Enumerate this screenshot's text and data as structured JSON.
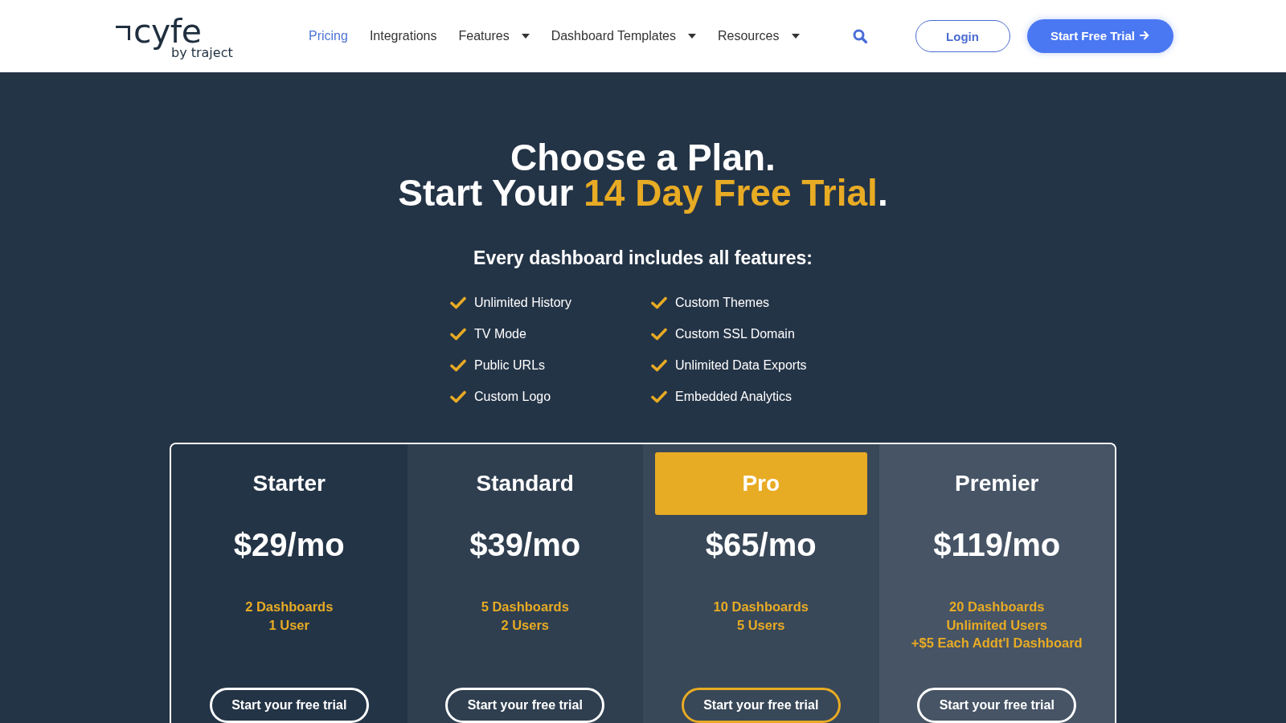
{
  "header": {
    "logo": {
      "wordmark": "cyfe",
      "tagline": "by traject"
    },
    "nav": [
      {
        "label": "Pricing",
        "selected": true,
        "kind": "link"
      },
      {
        "label": "Integrations",
        "selected": false,
        "kind": "link"
      },
      {
        "label": "Features",
        "selected": false,
        "kind": "dropdown"
      },
      {
        "label": "Dashboard Templates",
        "selected": false,
        "kind": "dropdown"
      },
      {
        "label": "Resources",
        "selected": false,
        "kind": "dropdown"
      }
    ],
    "buttons": [
      {
        "label": "Login",
        "kind": "outline"
      },
      {
        "label": "Start Free Trial",
        "kind": "primary"
      }
    ]
  },
  "hero": {
    "heading": {
      "line_1": "Choose a Plan.",
      "line_2": [
        {
          "text": "Start Your ",
          "accent": false
        },
        {
          "text": "14 Day Free Trial",
          "accent": true
        },
        {
          "text": ".",
          "accent": false
        }
      ]
    },
    "subheading": "Every dashboard includes all features:",
    "feature_columns": [
      [
        "Unlimited History",
        "TV Mode",
        "Public URLs",
        "Custom Logo"
      ],
      [
        "Custom Themes",
        "Custom SSL Domain",
        "Unlimited Data Exports",
        "Embedded Analytics"
      ]
    ]
  },
  "plans": [
    {
      "name": "Starter",
      "price": "$29/mo",
      "features": [
        "2 Dashboards",
        "1 User"
      ],
      "button": "Start your free trial",
      "featured": false
    },
    {
      "name": "Standard",
      "price": "$39/mo",
      "features": [
        "5 Dashboards",
        "2 Users"
      ],
      "button": "Start your free trial",
      "featured": false
    },
    {
      "name": "Pro",
      "price": "$65/mo",
      "features": [
        "10 Dashboards",
        "5 Users"
      ],
      "button": "Start your free trial",
      "featured": true
    },
    {
      "name": "Premier",
      "price": "$119/mo",
      "features": [
        "20 Dashboards",
        "Unlimited Users",
        "+$5 Each Addt'l Dashboard"
      ],
      "button": "Start your free trial",
      "featured": false
    }
  ]
}
